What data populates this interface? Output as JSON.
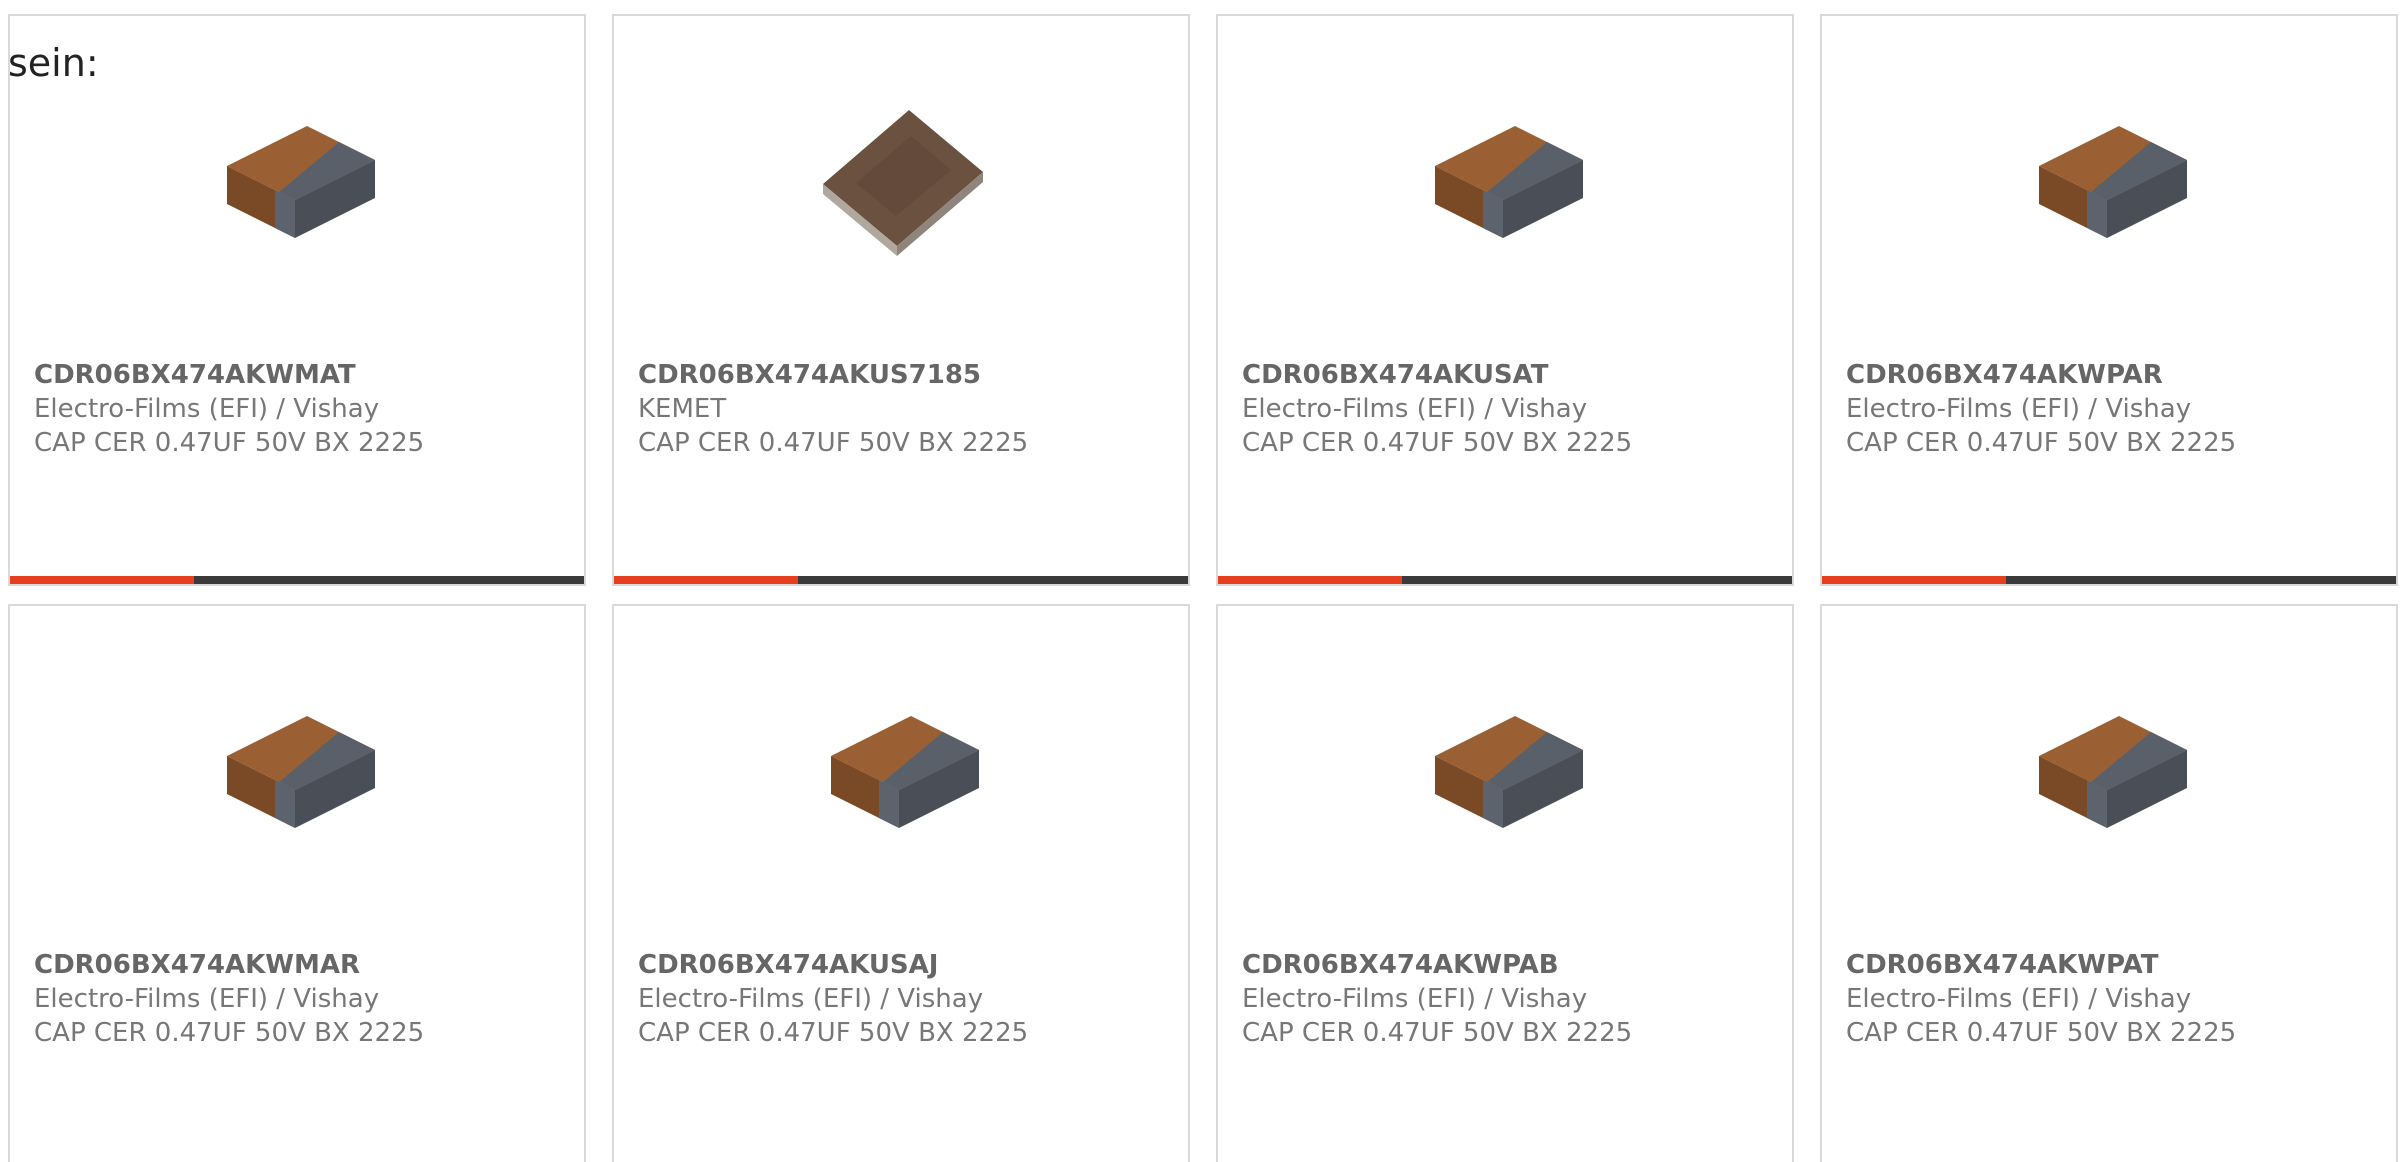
{
  "intro_text": "sein:",
  "colors": {
    "accent": "#e4401f",
    "bar_track": "#3a3a3a",
    "card_border": "#d9d9d9",
    "text": "#777777"
  },
  "products": [
    {
      "part_number": "CDR06BX474AKWMAT",
      "manufacturer": "Electro-Films (EFI) / Vishay",
      "description": "CAP CER 0.47UF 50V BX 2225",
      "image_icon": "ceramic-capacitor-chip-icon",
      "progress": 0.32
    },
    {
      "part_number": "CDR06BX474AKUS7185",
      "manufacturer": "KEMET",
      "description": "CAP CER 0.47UF 50V BX 2225",
      "image_icon": "ceramic-capacitor-flat-chip-icon",
      "progress": 0.32
    },
    {
      "part_number": "CDR06BX474AKUSAT",
      "manufacturer": "Electro-Films (EFI) / Vishay",
      "description": "CAP CER 0.47UF 50V BX 2225",
      "image_icon": "ceramic-capacitor-chip-icon",
      "progress": 0.32
    },
    {
      "part_number": "CDR06BX474AKWPAR",
      "manufacturer": "Electro-Films (EFI) / Vishay",
      "description": "CAP CER 0.47UF 50V BX 2225",
      "image_icon": "ceramic-capacitor-chip-icon",
      "progress": 0.32
    },
    {
      "part_number": "CDR06BX474AKWMAR",
      "manufacturer": "Electro-Films (EFI) / Vishay",
      "description": "CAP CER 0.47UF 50V BX 2225",
      "image_icon": "ceramic-capacitor-chip-icon"
    },
    {
      "part_number": "CDR06BX474AKUSAJ",
      "manufacturer": "Electro-Films (EFI) / Vishay",
      "description": "CAP CER 0.47UF 50V BX 2225",
      "image_icon": "ceramic-capacitor-chip-icon"
    },
    {
      "part_number": "CDR06BX474AKWPAB",
      "manufacturer": "Electro-Films (EFI) / Vishay",
      "description": "CAP CER 0.47UF 50V BX 2225",
      "image_icon": "ceramic-capacitor-chip-icon"
    },
    {
      "part_number": "CDR06BX474AKWPAT",
      "manufacturer": "Electro-Films (EFI) / Vishay",
      "description": "CAP CER 0.47UF 50V BX 2225",
      "image_icon": "ceramic-capacitor-chip-icon"
    }
  ]
}
